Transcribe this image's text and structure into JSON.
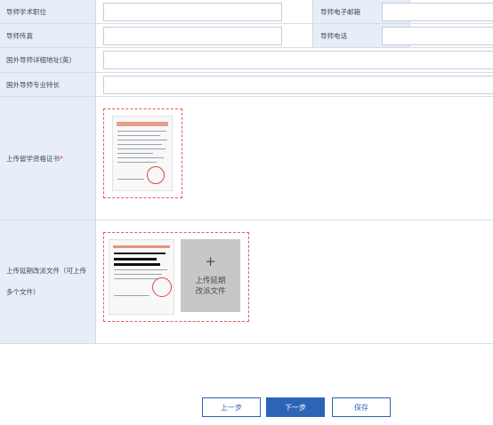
{
  "form": {
    "rows": [
      {
        "label": "导师学术职位",
        "right_label": "导师电子邮箱"
      },
      {
        "label": "导师传真",
        "right_label": "导师电话"
      },
      {
        "label": "国外导师详细地址(英)"
      },
      {
        "label": "国外导师专业特长"
      }
    ],
    "upload_certificate": {
      "label": "上传留学资格证书",
      "required_mark": "*"
    },
    "upload_deferral": {
      "label": "上传延期改派文件（可上传多个文件）",
      "add_tile_plus": "+",
      "add_tile_text": "上传延期改派文件"
    }
  },
  "buttons": {
    "prev": "上一步",
    "next": "下一步",
    "save": "保存"
  },
  "colors": {
    "label_bg": "#e7eef8",
    "primary": "#2c64b6",
    "required": "#e23c3c"
  }
}
